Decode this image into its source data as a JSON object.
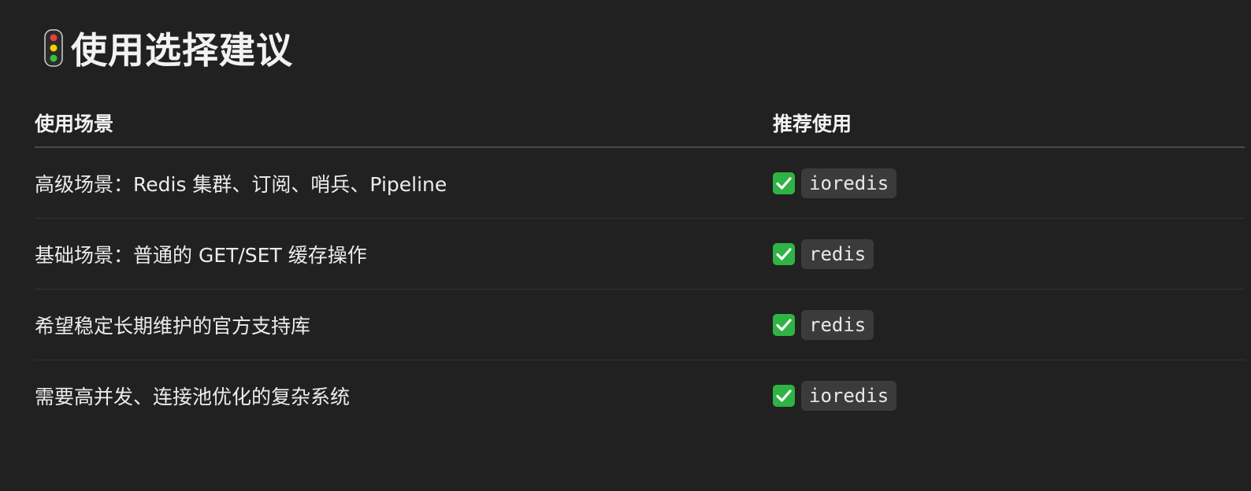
{
  "heading": {
    "icon": "traffic-light-icon",
    "title": "使用选择建议"
  },
  "table": {
    "headers": [
      "使用场景",
      "推荐使用"
    ],
    "rows": [
      {
        "scenario": "高级场景：Redis 集群、订阅、哨兵、Pipeline",
        "icon": "check-mark-icon",
        "recommend": "ioredis"
      },
      {
        "scenario": "基础场景：普通的 GET/SET 缓存操作",
        "icon": "check-mark-icon",
        "recommend": "redis"
      },
      {
        "scenario": "希望稳定长期维护的官方支持库",
        "icon": "check-mark-icon",
        "recommend": "redis"
      },
      {
        "scenario": "需要高并发、连接池优化的复杂系统",
        "icon": "check-mark-icon",
        "recommend": "ioredis"
      }
    ]
  },
  "colors": {
    "background": "#212121",
    "check_green": "#2fb344",
    "chip_background": "#3b3b3b"
  }
}
